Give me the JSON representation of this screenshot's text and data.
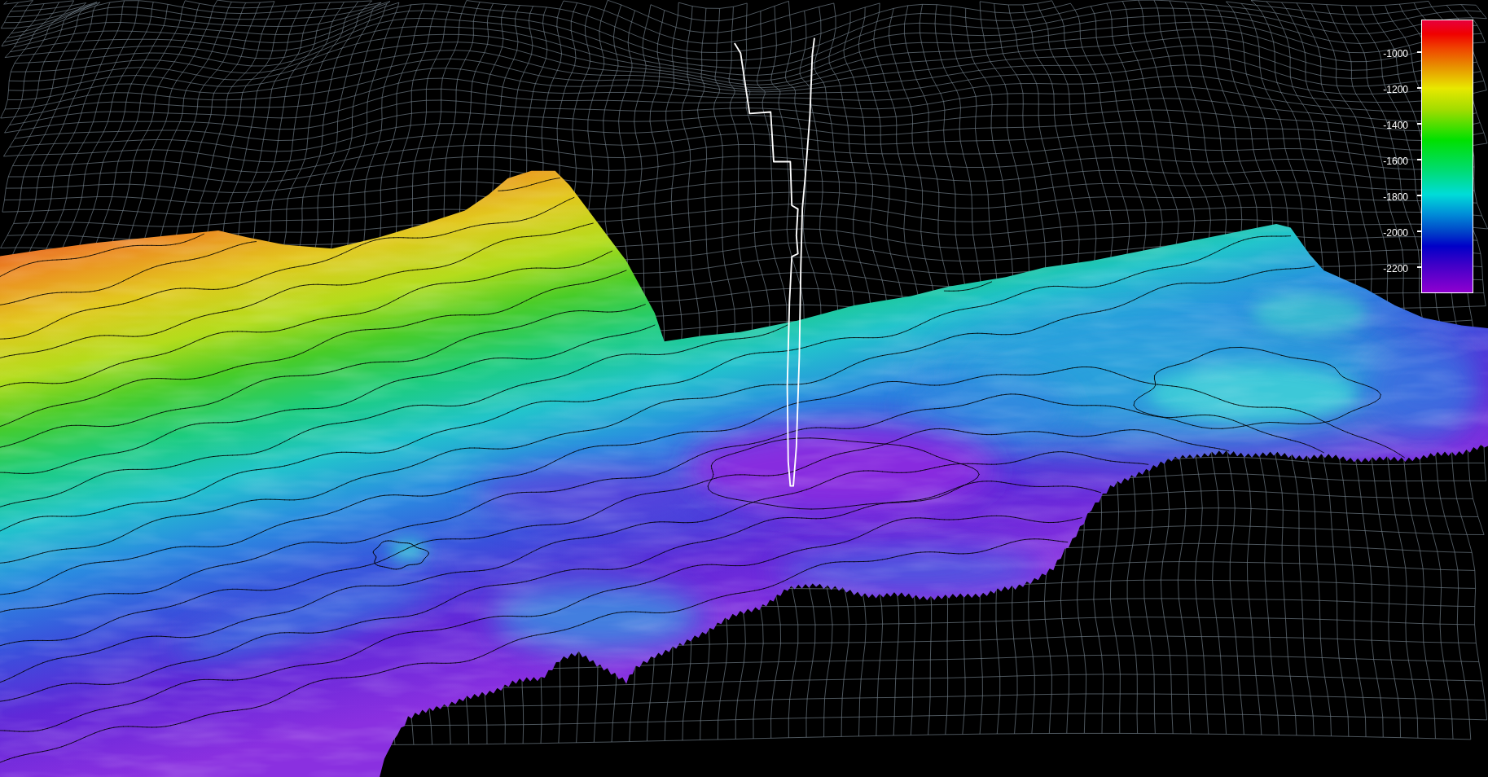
{
  "color_scale": {
    "ticks": [
      "-1000",
      "-1200",
      "-1400",
      "-1600",
      "-1800",
      "-2000",
      "-2200"
    ]
  }
}
